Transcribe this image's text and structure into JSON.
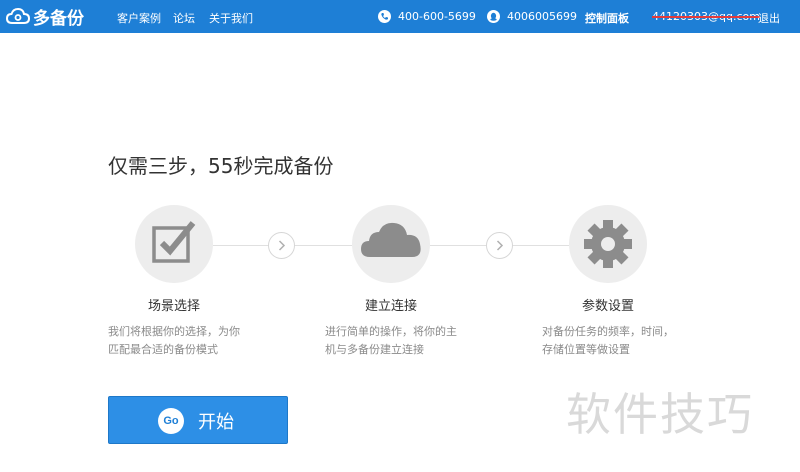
{
  "header": {
    "logo_text": "多备份",
    "nav": [
      "客户案例",
      "论坛",
      "关于我们"
    ],
    "phone": "400-600-5699",
    "qq": "4006005699",
    "control_panel": "控制面板",
    "user_email": "44120303@qq.com",
    "logout": "退出"
  },
  "main": {
    "title": "仅需三步，55秒完成备份",
    "steps": [
      {
        "icon": "checkbox-edit-icon",
        "title": "场景选择",
        "desc_lines": [
          "我们将根据你的选择，为你",
          "匹配最合适的备份模式"
        ]
      },
      {
        "icon": "cloud-icon",
        "title": "建立连接",
        "desc_lines": [
          "进行简单的操作，将你的主",
          "机与多备份建立连接"
        ]
      },
      {
        "icon": "gear-icon",
        "title": "参数设置",
        "desc_lines": [
          "对备份任务的频率，时间，",
          "存储位置等做设置"
        ]
      }
    ],
    "go_badge": "Go",
    "start_label": "开始"
  },
  "watermark": "软件技巧",
  "colors": {
    "header_bg": "#1e7fd6",
    "button_bg": "#2d8fe6",
    "icon_gray": "#8c8c8c",
    "step_bg": "#ededed"
  }
}
